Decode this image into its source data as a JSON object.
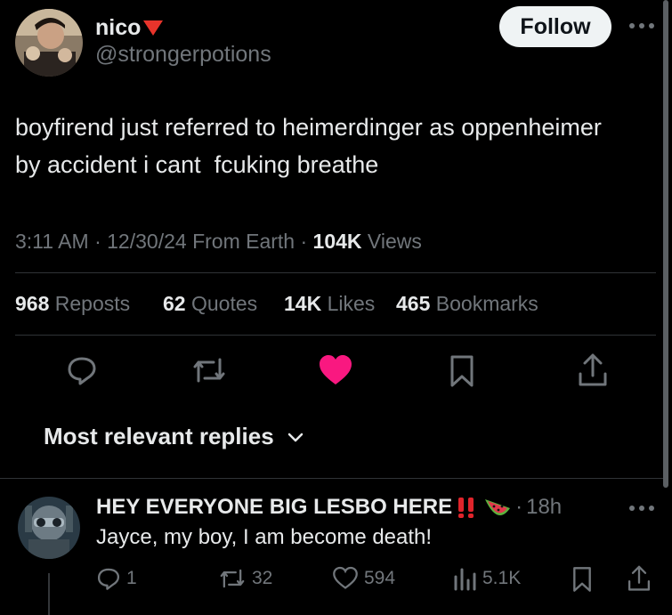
{
  "post": {
    "display_name": "nico",
    "handle": "@strongerpotions",
    "follow_label": "Follow",
    "text_line1": "boyfirend just referred to heimerdinger as oppenheimer",
    "text_line2": "by accident i cant  fcuking breathe",
    "time": "3:11 AM",
    "sep": "·",
    "date": "12/30/24",
    "source": "From Earth",
    "views_count": "104K",
    "views_label": "Views",
    "stats": {
      "reposts_count": "968",
      "reposts_label": "Reposts",
      "quotes_count": "62",
      "quotes_label": "Quotes",
      "likes_count": "14K",
      "likes_label": "Likes",
      "bookmarks_count": "465",
      "bookmarks_label": "Bookmarks"
    },
    "liked": true,
    "accent_like": "#f91880"
  },
  "replies_sort": {
    "label": "Most relevant replies"
  },
  "reply": {
    "display_name": "HEY EVERYONE BIG LESBO HERE",
    "badge": "‼️",
    "emoji": "watermelon",
    "sep": "·",
    "time": "18h",
    "text": "Jayce, my boy, I am become death!",
    "replies": "1",
    "reposts": "32",
    "likes": "594",
    "views": "5.1K"
  },
  "colors": {
    "background": "#000000",
    "text": "#e7e9ea",
    "muted": "#71767b",
    "divider": "#2f3336"
  }
}
